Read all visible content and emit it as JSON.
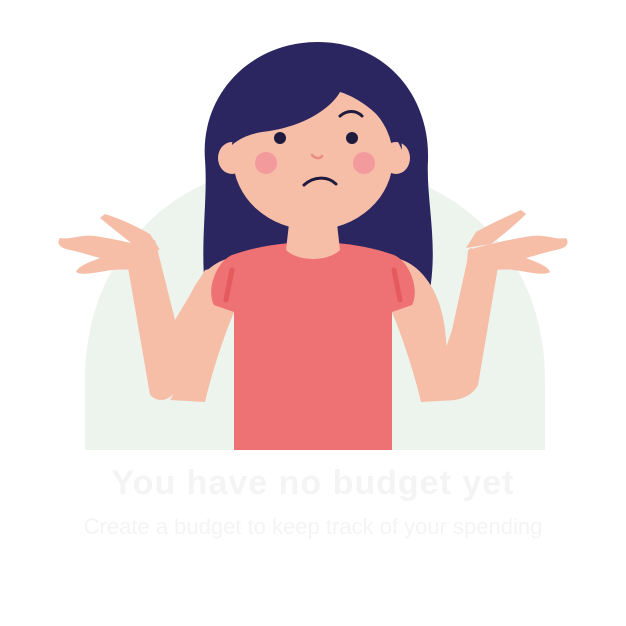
{
  "empty_state": {
    "title": "You have no budget yet",
    "subtitle": "Create a budget to keep track of your spending"
  },
  "illustration": {
    "icon": "shrugging-woman-icon",
    "colors": {
      "hair": "#2b2560",
      "skin": "#f6bda7",
      "shirt": "#ee7273",
      "shirt_accent": "#e55a5d",
      "cheeks": "#f39a9c",
      "backdrop": "#edf4ee",
      "features": "#1f1b3f"
    }
  }
}
